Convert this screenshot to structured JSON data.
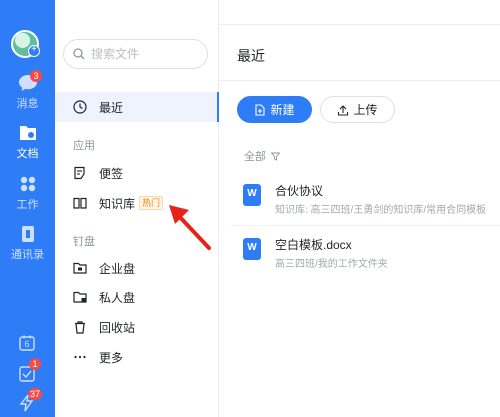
{
  "rail": {
    "items": [
      {
        "key": "messages",
        "label": "消息",
        "badge": "3"
      },
      {
        "key": "docs",
        "label": "文档",
        "badge": ""
      },
      {
        "key": "work",
        "label": "工作",
        "badge": ""
      },
      {
        "key": "contacts",
        "label": "通讯录",
        "badge": ""
      }
    ],
    "calendar_day": "6",
    "todo_badge": "1",
    "bottom_badge": "37"
  },
  "nav": {
    "search_placeholder": "搜索文件",
    "recent_label": "最近",
    "apps_section": "应用",
    "notes_label": "便签",
    "knowledge_label": "知识库",
    "hot_tag": "热门",
    "drives_section": "钉盘",
    "enterprise_label": "企业盘",
    "private_label": "私人盘",
    "recycle_label": "回收站",
    "more_label": "更多"
  },
  "main": {
    "title": "最近",
    "new_button": "新建",
    "upload_button": "上传",
    "filter_label": "全部",
    "files": [
      {
        "name": "合伙协议",
        "path": "知识库: 高三四班/王勇剑的知识库/常用合同模板",
        "icon_letter": "W"
      },
      {
        "name": "空白模板.docx",
        "path": "高三四班/我的工作文件夹",
        "icon_letter": "W"
      }
    ]
  },
  "colors": {
    "brand": "#2f7df6",
    "badge": "#f54a45",
    "hot": "#ff7d00",
    "annotation": "#e8221b"
  }
}
